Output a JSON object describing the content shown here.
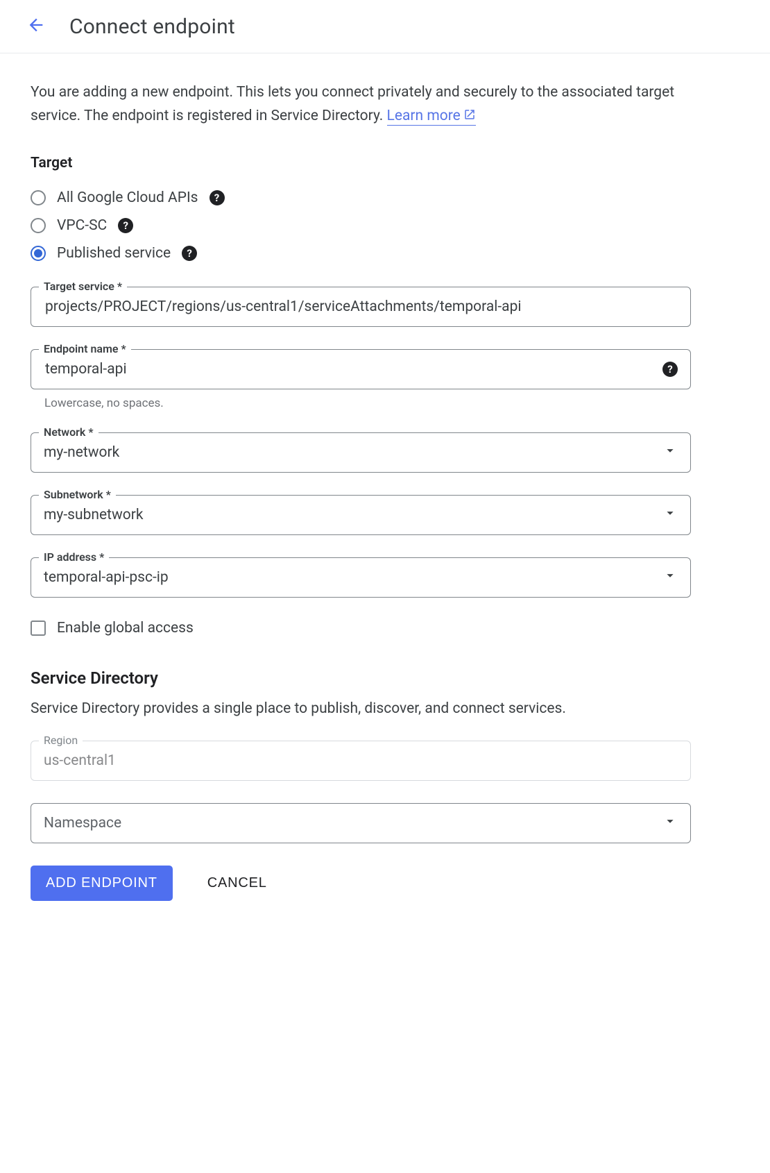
{
  "header": {
    "title": "Connect endpoint"
  },
  "intro": {
    "text": "You are adding a new endpoint. This lets you connect privately and securely to the associated target service. The endpoint is registered in Service Directory. ",
    "learn_more": "Learn more"
  },
  "target": {
    "section_label": "Target",
    "options": [
      {
        "label": "All Google Cloud APIs",
        "selected": false
      },
      {
        "label": "VPC-SC",
        "selected": false
      },
      {
        "label": "Published service",
        "selected": true
      }
    ]
  },
  "fields": {
    "target_service": {
      "label": "Target service *",
      "value": "projects/PROJECT/regions/us-central1/serviceAttachments/temporal-api"
    },
    "endpoint_name": {
      "label": "Endpoint name *",
      "value": "temporal-api",
      "helper": "Lowercase, no spaces."
    },
    "network": {
      "label": "Network *",
      "value": "my-network"
    },
    "subnetwork": {
      "label": "Subnetwork *",
      "value": "my-subnetwork"
    },
    "ip_address": {
      "label": "IP address *",
      "value": "temporal-api-psc-ip"
    },
    "global_access": {
      "label": "Enable global access",
      "checked": false
    }
  },
  "service_directory": {
    "title": "Service Directory",
    "description": "Service Directory provides a single place to publish, discover, and connect services.",
    "region": {
      "label": "Region",
      "value": "us-central1"
    },
    "namespace": {
      "placeholder": "Namespace"
    }
  },
  "actions": {
    "primary": "ADD ENDPOINT",
    "cancel": "CANCEL"
  }
}
